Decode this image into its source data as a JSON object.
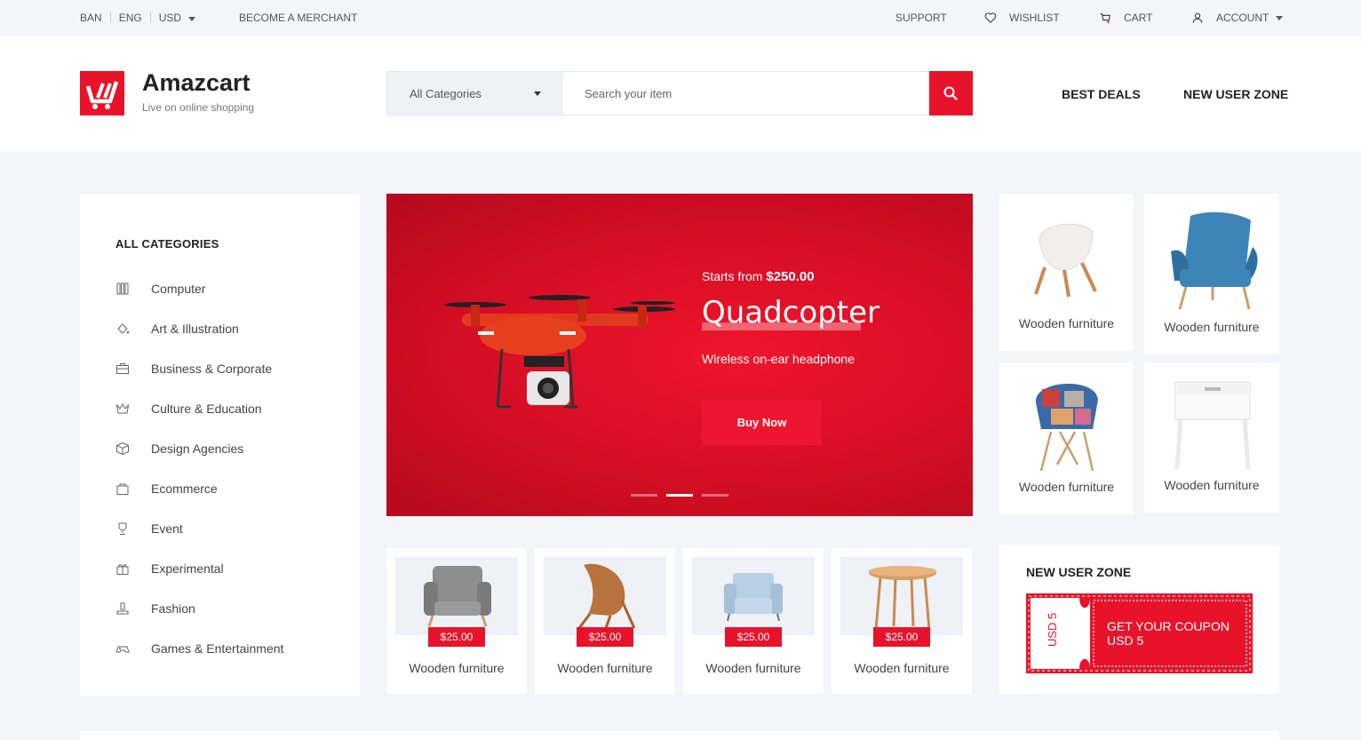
{
  "topbar": {
    "lang1": "BAN",
    "lang2": "ENG",
    "currency": "USD",
    "merchant": "BECOME A MERCHANT",
    "support": "SUPPORT",
    "wishlist": "WISHLIST",
    "cart": "CART",
    "account": "ACCOUNT"
  },
  "brand": {
    "name": "Amazcart",
    "tagline": "Live on online shopping",
    "color": "#e8132a"
  },
  "search": {
    "category": "All Categories",
    "placeholder": "Search your item"
  },
  "header_links": {
    "best_deals": "BEST DEALS",
    "new_user_zone": "NEW USER ZONE"
  },
  "sidebar": {
    "title": "ALL CATEGORIES",
    "items": [
      {
        "label": "Computer",
        "icon": "computer-icon"
      },
      {
        "label": "Art & Illustration",
        "icon": "paint-bucket-icon"
      },
      {
        "label": "Business & Corporate",
        "icon": "briefcase-icon"
      },
      {
        "label": "Culture & Education",
        "icon": "crown-icon"
      },
      {
        "label": "Design Agencies",
        "icon": "box-icon"
      },
      {
        "label": "Ecommerce",
        "icon": "shopping-bag-icon"
      },
      {
        "label": "Event",
        "icon": "trophy-icon"
      },
      {
        "label": "Experimental",
        "icon": "gift-icon"
      },
      {
        "label": "Fashion",
        "icon": "stamp-icon"
      },
      {
        "label": "Games & Entertainment",
        "icon": "gamepad-icon"
      }
    ]
  },
  "hero": {
    "starts_prefix": "Starts from",
    "price": "$250.00",
    "title": "Quadcopter",
    "subtitle": "Wireless on-ear headphone",
    "button": "Buy Now",
    "active_slide": 2,
    "slide_count": 3
  },
  "side_tiles": [
    {
      "name": "Wooden furniture",
      "image": "shell-chair"
    },
    {
      "name": "Wooden furniture",
      "image": "blue-armchair"
    },
    {
      "name": "Wooden furniture",
      "image": "patchwork-chair"
    },
    {
      "name": "Wooden furniture",
      "image": "white-nightstand"
    }
  ],
  "products": [
    {
      "name": "Wooden furniture",
      "price": "$25.00",
      "image": "grey-armchair"
    },
    {
      "name": "Wooden furniture",
      "price": "$25.00",
      "image": "shell-chair"
    },
    {
      "name": "Wooden furniture",
      "price": "$25.00",
      "image": "blue-armchair"
    },
    {
      "name": "Wooden furniture",
      "price": "$25.00",
      "image": "round-table"
    }
  ],
  "new_user_zone": {
    "title": "NEW USER ZONE",
    "coupon_side": "USD 5",
    "coupon_text": "GET YOUR COUPON USD 5"
  }
}
